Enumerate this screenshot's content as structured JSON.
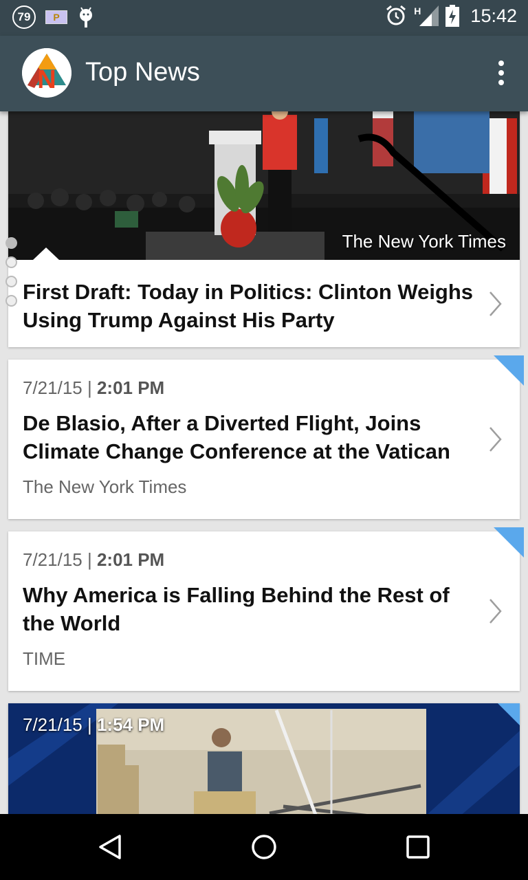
{
  "status_bar": {
    "notification_count": "79",
    "parking_badge": "P",
    "network_type": "H",
    "time": "15:42",
    "icons": [
      "notification-count-icon",
      "parking-icon",
      "android-debug-icon",
      "alarm-icon",
      "signal-icon",
      "battery-charging-icon"
    ]
  },
  "app_bar": {
    "title": "Top News",
    "logo_letter": "N",
    "menu_icon": "overflow-menu-icon"
  },
  "articles": [
    {
      "source": "The New York Times",
      "headline": "First Draft: Today in Politics: Clinton Weighs Using Trump Against His Party"
    },
    {
      "date": "7/21/15 | ",
      "time": "2:01 PM",
      "headline": "De Blasio, After a Diverted Flight, Joins Climate Change Conference at the Vatican",
      "source": "The New York Times"
    },
    {
      "date": "7/21/15 | ",
      "time": "2:01 PM",
      "headline": "Why America is Falling Behind the Rest of the World",
      "source": "TIME"
    },
    {
      "date": "7/21/15 | ",
      "time": "1:54 PM"
    }
  ],
  "colors": {
    "status_bar": "#37474f",
    "app_bar": "#3d4f58",
    "new_badge": "#5aa8ec"
  }
}
